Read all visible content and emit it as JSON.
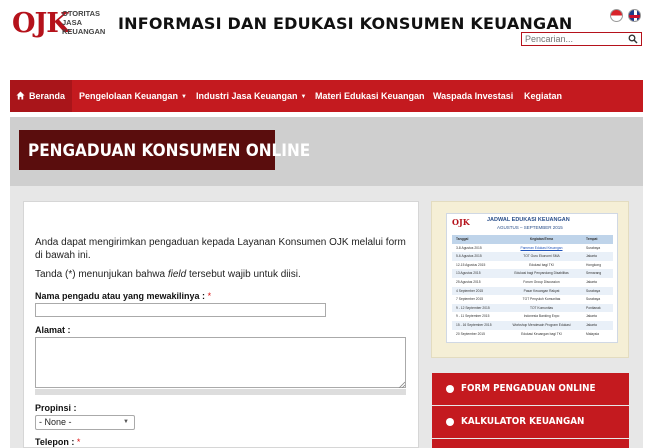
{
  "header": {
    "logo_mark": "OJK",
    "logo_lines": [
      "OTORITAS",
      "JASA",
      "KEUANGAN"
    ],
    "site_title": "INFORMASI DAN EDUKASI KONSUMEN KEUANGAN",
    "languages": [
      "id-flag-icon",
      "en-flag-icon"
    ],
    "search": {
      "placeholder": "Pencarian..."
    }
  },
  "nav": {
    "items": [
      {
        "label": "Beranda",
        "icon": "home-icon",
        "dropdown": false
      },
      {
        "label": "Pengelolaan Keuangan",
        "dropdown": true
      },
      {
        "label": "Industri Jasa Keuangan",
        "dropdown": true
      },
      {
        "label": "Materi Edukasi Keuangan",
        "dropdown": false
      },
      {
        "label": "Waspada Investasi",
        "dropdown": false
      },
      {
        "label": "Kegiatan",
        "dropdown": false
      }
    ]
  },
  "banner": {
    "title": "PENGADUAN KONSUMEN ONLINE"
  },
  "form": {
    "intro": "Anda dapat mengirimkan pengaduan kepada Layanan Konsumen OJK melalui form di bawah ini.",
    "note_before": "Tanda (*) menunjukan bahwa ",
    "note_field": "field",
    "note_after": " tersebut wajib untuk diisi.",
    "name_label": "Nama pengadu atau yang mewakilinya : ",
    "required_mark": "*",
    "address_label": "Alamat :",
    "province_label": "Propinsi :",
    "province_value": "- None -",
    "phone_label": "Telepon : "
  },
  "sidebar": {
    "schedule": {
      "logo": "OJK",
      "title": "JADWAL EDUKASI KEUANGAN",
      "subtitle": "AGUSTUS – SEPTEMBER 2015",
      "header": [
        "Tanggal",
        "Kegiatan/Tema",
        "Tempat"
      ],
      "rows": [
        [
          "3-8 Agustus 2015",
          "Pameran Edukasi Keuangan",
          "Surabaya"
        ],
        [
          "5-6 Agustus 2015",
          "TOT Guru Ekonomi SMA",
          "Jakarta"
        ],
        [
          "12-15 Agustus 2015",
          "Edukasi bagi TKI",
          "Hongkong"
        ],
        [
          "13 Agustus 2015",
          "Edukasi bagi Penyandang Disabilitas",
          "Semarang"
        ],
        [
          "25 Agustus 2015",
          "Forum Group Discussion",
          "Jakarta"
        ],
        [
          "4 September 2015",
          "Pasar Keuangan Rakyat",
          "Surabaya"
        ],
        [
          "7 September 2015",
          "TOT Penyuluh Komunitas",
          "Surabaya"
        ],
        [
          "9 - 12 September 2015",
          "TOT Komunitas",
          "Pontianak"
        ],
        [
          "9 - 11 September 2015",
          "Indonesia Banking Expo",
          "Jakarta"
        ],
        [
          "15 - 16 September 2015",
          "Workshop Mendesain Program Edukasi",
          "Jakarta"
        ],
        [
          "20 September 2015",
          "Edukasi Keuangan bagi TKI",
          "Malaysia"
        ]
      ]
    },
    "buttons": [
      {
        "label": "FORM PENGADUAN ONLINE"
      },
      {
        "label": "KALKULATOR KEUANGAN"
      }
    ]
  },
  "colors": {
    "brand_red": "#c41a1f",
    "dark_red": "#5a0d0d",
    "banner_grey": "#cfcfcf"
  }
}
